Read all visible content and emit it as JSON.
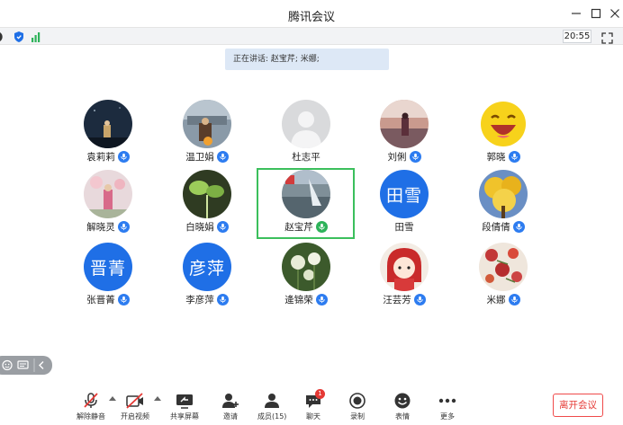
{
  "window": {
    "title": "腾讯会议",
    "minimize_icon": "minimize-icon",
    "maximize_icon": "maximize-icon",
    "close_icon": "close-icon"
  },
  "statusbar": {
    "time": "20:55",
    "icons": [
      "network-left-icon",
      "shield-icon",
      "signal-bars-icon",
      "fullscreen-icon"
    ]
  },
  "speaking": {
    "text": "正在讲话: 赵宝芹; 米娜;"
  },
  "participants": [
    {
      "name": "袁莉莉",
      "avatar": "photo-night-sky",
      "mic": "on"
    },
    {
      "name": "温卫娟",
      "avatar": "photo-city-night",
      "mic": "on"
    },
    {
      "name": "杜志平",
      "avatar": "default-silhouette",
      "mic": "none"
    },
    {
      "name": "刘俐",
      "avatar": "photo-sunset-girl",
      "mic": "on"
    },
    {
      "name": "郭晓",
      "avatar": "emoji-laughing",
      "mic": "on"
    },
    {
      "name": "解晓灵",
      "avatar": "photo-flowers",
      "mic": "on"
    },
    {
      "name": "白晓娟",
      "avatar": "photo-green-sprout",
      "mic": "on"
    },
    {
      "name": "赵宝芹",
      "avatar": "photo-lake",
      "mic": "speaking"
    },
    {
      "name": "田雪",
      "avatar_text": "田雪",
      "mic": "none"
    },
    {
      "name": "段倩倩",
      "avatar": "photo-yellow-tree",
      "mic": "on"
    },
    {
      "name": "张晋菁",
      "avatar_text": "晋菁",
      "mic": "on"
    },
    {
      "name": "李彦萍",
      "avatar_text": "彦萍",
      "mic": "on"
    },
    {
      "name": "逄锦荣",
      "avatar": "photo-dandelion",
      "mic": "on"
    },
    {
      "name": "汪芸芳",
      "avatar": "cartoon-girl",
      "mic": "on"
    },
    {
      "name": "米娜",
      "avatar": "photo-red-flowers",
      "mic": "on"
    }
  ],
  "toolbar": {
    "unmute": "解除静音",
    "video": "开启视频",
    "share": "共享屏幕",
    "invite": "邀请",
    "members": "成员(15)",
    "chat": "聊天",
    "chat_badge": "1",
    "record": "录制",
    "emoji": "表情",
    "more": "更多",
    "leave": "离开会议"
  },
  "colors": {
    "accent": "#1f6fe6",
    "speaking_green": "#3bbf5c",
    "leave_red": "#e53935"
  }
}
